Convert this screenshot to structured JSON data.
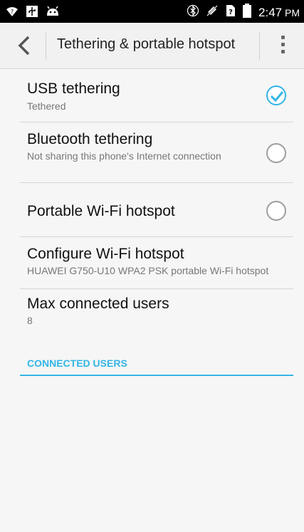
{
  "status_bar": {
    "time": "2:47",
    "ampm": "PM",
    "icons": [
      "wifi-question-icon",
      "usb-icon",
      "android-icon",
      "bluetooth-icon",
      "mute-icon",
      "sim-question-icon",
      "battery-icon"
    ]
  },
  "action_bar": {
    "title": "Tethering & portable hotspot",
    "back_icon": "chevron-left-icon",
    "menu_icon": "overflow-menu-icon"
  },
  "settings": {
    "usb": {
      "title": "USB tethering",
      "summary": "Tethered",
      "checked": true
    },
    "bluetooth": {
      "title": "Bluetooth tethering",
      "summary": "Not sharing this phone's Internet connection",
      "checked": false
    },
    "wifi_hotspot": {
      "title": "Portable Wi-Fi hotspot",
      "checked": false
    },
    "configure": {
      "title": "Configure Wi-Fi hotspot",
      "summary": "HUAWEI G750-U10 WPA2 PSK portable Wi-Fi hotspot"
    },
    "max_users": {
      "title": "Max connected users",
      "value": "8"
    }
  },
  "section": {
    "connected_users": "CONNECTED USERS"
  },
  "colors": {
    "accent": "#33b5e5",
    "status_bar": "#000000",
    "background": "#f6f6f6"
  }
}
